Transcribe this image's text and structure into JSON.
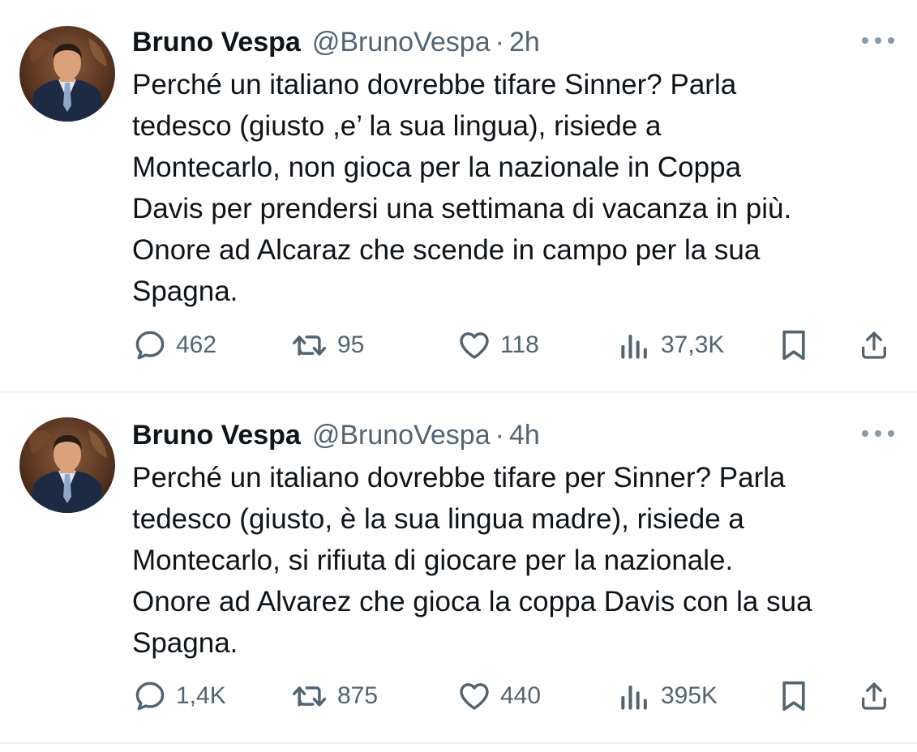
{
  "tweets": [
    {
      "author": {
        "name": "Bruno Vespa",
        "handle": "@BrunoVespa"
      },
      "separator": "·",
      "time": "2h",
      "text_lines": [
        "Perché un italiano dovrebbe tifare Sinner? Parla",
        "tedesco (giusto ,e’ la sua lingua), risiede a",
        "Montecarlo, non gioca per la nazionale in Coppa",
        "Davis per prendersi una settimana di vacanza in più.",
        "Onore ad Alcaraz che scende in campo per la sua",
        "Spagna."
      ],
      "actions": {
        "replies": "462",
        "retweets": "95",
        "likes": "118",
        "views": "37,3K"
      },
      "icons": {
        "more": "more-horizontal-icon",
        "reply": "reply-icon",
        "retweet": "retweet-icon",
        "like": "heart-icon",
        "views": "views-icon",
        "bookmark": "bookmark-icon",
        "share": "share-icon"
      }
    },
    {
      "author": {
        "name": "Bruno Vespa",
        "handle": "@BrunoVespa"
      },
      "separator": "·",
      "time": "4h",
      "text_lines": [
        "Perché un italiano dovrebbe tifare per Sinner? Parla",
        "tedesco (giusto, è la sua lingua madre), risiede a",
        "Montecarlo, si rifiuta di giocare per la nazionale.",
        "Onore ad Alvarez che gioca la coppa Davis con la sua",
        "Spagna."
      ],
      "actions": {
        "replies": "1,4K",
        "retweets": "875",
        "likes": "440",
        "views": "395K"
      },
      "icons": {
        "more": "more-horizontal-icon",
        "reply": "reply-icon",
        "retweet": "retweet-icon",
        "like": "heart-icon",
        "views": "views-icon",
        "bookmark": "bookmark-icon",
        "share": "share-icon"
      }
    }
  ],
  "colors": {
    "text_primary": "#0f1419",
    "text_secondary": "#536471",
    "divider": "#eff3f4"
  }
}
